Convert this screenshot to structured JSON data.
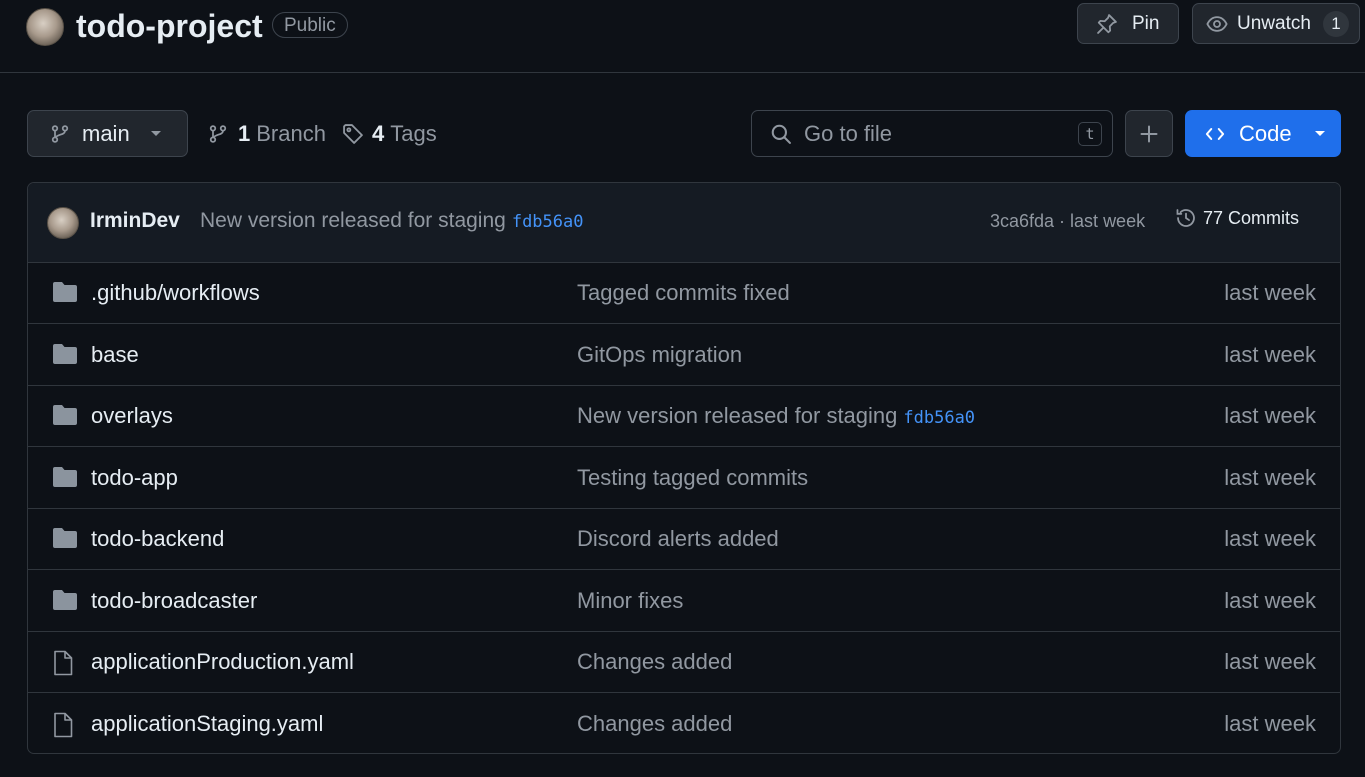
{
  "repo": {
    "name": "todo-project",
    "visibility": "Public"
  },
  "actions": {
    "pin_label": "Pin",
    "watch_label": "Unwatch",
    "watch_count": "1"
  },
  "toolbar": {
    "branch": "main",
    "branches_count": "1",
    "branches_label": "Branch",
    "tags_count": "4",
    "tags_label": "Tags",
    "search_placeholder": "Go to file",
    "search_shortcut": "t",
    "code_label": "Code"
  },
  "latest_commit": {
    "author": "IrminDev",
    "message": "New version released for staging",
    "message_sha": "fdb56a0",
    "meta": "3ca6fda · last week",
    "commits_label": "77 Commits"
  },
  "files": [
    {
      "type": "folder",
      "name": ".github/workflows",
      "message": "Tagged commits fixed",
      "sha": "",
      "time": "last week"
    },
    {
      "type": "folder",
      "name": "base",
      "message": "GitOps migration",
      "sha": "",
      "time": "last week"
    },
    {
      "type": "folder",
      "name": "overlays",
      "message": "New version released for staging",
      "sha": "fdb56a0",
      "time": "last week"
    },
    {
      "type": "folder",
      "name": "todo-app",
      "message": "Testing tagged commits",
      "sha": "",
      "time": "last week"
    },
    {
      "type": "folder",
      "name": "todo-backend",
      "message": "Discord alerts added",
      "sha": "",
      "time": "last week"
    },
    {
      "type": "folder",
      "name": "todo-broadcaster",
      "message": "Minor fixes",
      "sha": "",
      "time": "last week"
    },
    {
      "type": "file",
      "name": "applicationProduction.yaml",
      "message": "Changes added",
      "sha": "",
      "time": "last week"
    },
    {
      "type": "file",
      "name": "applicationStaging.yaml",
      "message": "Changes added",
      "sha": "",
      "time": "last week"
    }
  ],
  "colors": {
    "background": "#0d1117",
    "accent": "#1f6feb",
    "link": "#4493f8",
    "muted": "#9198a1",
    "border": "#30363d"
  }
}
